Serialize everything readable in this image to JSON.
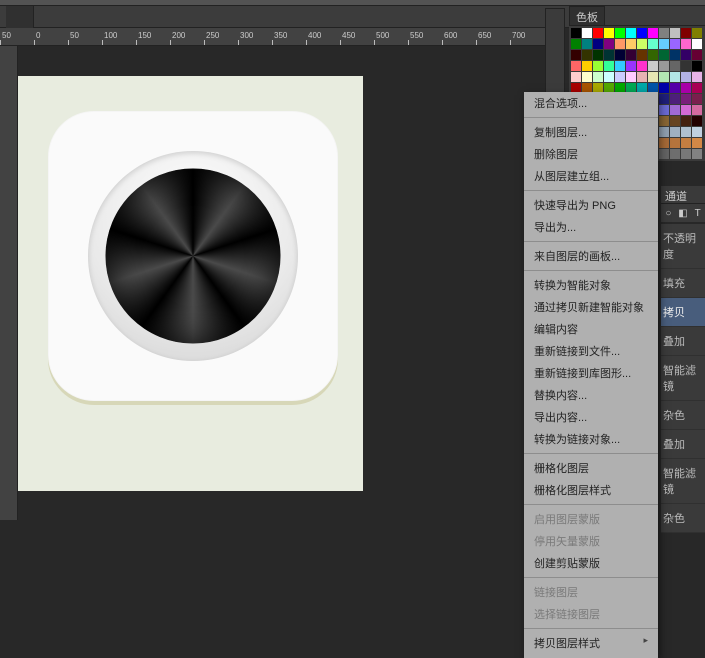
{
  "top_tabs": [
    "",
    ""
  ],
  "ruler_ticks": [
    "50",
    "0",
    "50",
    "100",
    "150",
    "200",
    "250",
    "300",
    "350",
    "400",
    "450",
    "500",
    "550",
    "600",
    "650",
    "700"
  ],
  "swatch_panel_tab": "色板",
  "swatch_colors": [
    "#000000",
    "#ffffff",
    "#ff0000",
    "#ffff00",
    "#00ff00",
    "#00ffff",
    "#0000ff",
    "#ff00ff",
    "#808080",
    "#c0c0c0",
    "#800000",
    "#808000",
    "#008000",
    "#008080",
    "#000080",
    "#800080",
    "#ff9966",
    "#ffcc66",
    "#ccff66",
    "#66ffcc",
    "#66ccff",
    "#9966ff",
    "#ff66cc",
    "#ffffff",
    "#330000",
    "#333300",
    "#003300",
    "#003333",
    "#000033",
    "#330033",
    "#663300",
    "#336600",
    "#006633",
    "#003366",
    "#330066",
    "#660033",
    "#ff6666",
    "#ffcc00",
    "#99ff33",
    "#33ff99",
    "#33ccff",
    "#9933ff",
    "#ff33cc",
    "#cccccc",
    "#999999",
    "#666666",
    "#333333",
    "#000000",
    "#ffcccc",
    "#ffffcc",
    "#ccffcc",
    "#ccffff",
    "#ccccff",
    "#ffccff",
    "#e6b3b3",
    "#e6e6b3",
    "#b3e6b3",
    "#b3e6e6",
    "#b3b3e6",
    "#e6b3e6",
    "#a80000",
    "#a85400",
    "#a8a800",
    "#54a800",
    "#00a800",
    "#00a854",
    "#00a8a8",
    "#0054a8",
    "#0000a8",
    "#5400a8",
    "#a800a8",
    "#a80054",
    "#7a1f1f",
    "#7a4d1f",
    "#7a7a1f",
    "#4d7a1f",
    "#1f7a1f",
    "#1f7a4d",
    "#1f7a7a",
    "#1f4d7a",
    "#1f1f7a",
    "#4d1f7a",
    "#7a1f7a",
    "#7a1f4d",
    "#d46a6a",
    "#d4a06a",
    "#d4d46a",
    "#a0d46a",
    "#6ad46a",
    "#6ad4a0",
    "#6ad4d4",
    "#6aa0d4",
    "#6a6ad4",
    "#a06ad4",
    "#d46ad4",
    "#d46aa0",
    "#552200",
    "#774400",
    "#996600",
    "#bb8800",
    "#ddaa00",
    "#ffcc00",
    "#ccaa55",
    "#aa8844",
    "#886633",
    "#664422",
    "#442211",
    "#220000",
    "#102030",
    "#203040",
    "#304050",
    "#405060",
    "#506070",
    "#607080",
    "#708090",
    "#8090a0",
    "#90a0b0",
    "#a0b0c0",
    "#b0c0d0",
    "#c0d0e0",
    "#2e1a0f",
    "#3d2414",
    "#4c2e19",
    "#5b381e",
    "#6a4223",
    "#794c28",
    "#88562d",
    "#976032",
    "#a66a37",
    "#b5743c",
    "#c47e41",
    "#d38846",
    "#141414",
    "#1e1e1e",
    "#282828",
    "#323232",
    "#3c3c3c",
    "#464646",
    "#505050",
    "#5a5a5a",
    "#646464",
    "#6e6e6e",
    "#787878",
    "#828282"
  ],
  "right_tabs_small": {
    "channel": "通道"
  },
  "mini_icon_glyphs": [
    "○",
    "◧",
    "T"
  ],
  "side_labels": {
    "opacity": "不透明度",
    "fill": "填充",
    "copy": "拷贝",
    "overlay1": "叠加",
    "smart_filter": "智能滤镜",
    "noise": "杂色",
    "overlay2": "叠加",
    "smart_filter2": "智能滤镜",
    "noise2": "杂色"
  },
  "context_menu": {
    "blending_options": "混合选项...",
    "duplicate_layer": "复制图层...",
    "delete_layer": "删除图层",
    "group_from_layers": "从图层建立组...",
    "quick_export_png": "快速导出为 PNG",
    "export_as": "导出为...",
    "artboard_from_layers": "来自图层的画板...",
    "convert_to_smart": "转换为智能对象",
    "new_smart_via_copy": "通过拷贝新建智能对象",
    "edit_contents": "编辑内容",
    "relink_to_file": "重新链接到文件...",
    "relink_to_library": "重新链接到库图形...",
    "replace_contents": "替换内容...",
    "export_contents": "导出内容...",
    "convert_to_linked": "转换为链接对象...",
    "rasterize_layer": "栅格化图层",
    "rasterize_layer_style": "栅格化图层样式",
    "enable_layer_mask": "启用图层蒙版",
    "enable_vector_mask": "停用矢量蒙版",
    "create_clipping_mask": "创建剪贴蒙版",
    "link_layers": "链接图层",
    "select_linked": "选择链接图层",
    "copy_layer_style": "拷贝图层样式"
  }
}
